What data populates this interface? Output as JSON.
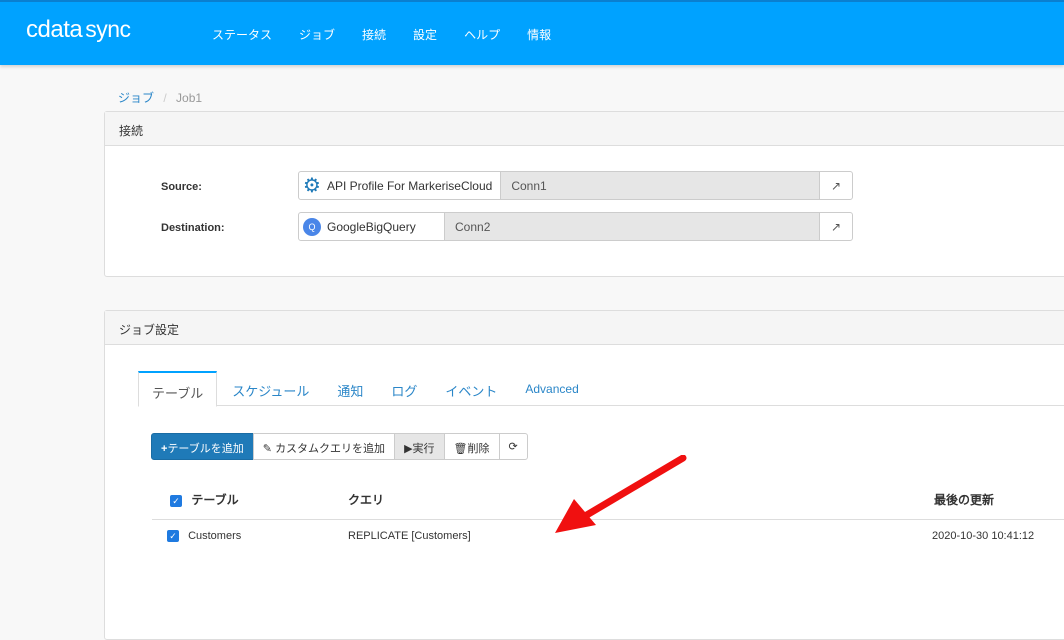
{
  "app": {
    "logo": "cdata",
    "logo_suffix": "sync",
    "accent": "#00a2ff"
  },
  "nav": [
    "ステータス",
    "ジョブ",
    "接続",
    "設定",
    "ヘルプ",
    "情報"
  ],
  "breadcrumb": {
    "parent": "ジョブ",
    "sep": "/",
    "current": "Job1"
  },
  "connections": {
    "title": "接続",
    "source": {
      "label": "Source:",
      "provider": "API Profile For MarkeriseCloud",
      "name": "Conn1"
    },
    "destination": {
      "label": "Destination:",
      "provider": "GoogleBigQuery",
      "name": "Conn2"
    }
  },
  "job": {
    "title": "ジョブ設定",
    "tabs": [
      "テーブル",
      "スケジュール",
      "通知",
      "ログ",
      "イベント",
      "Advanced"
    ],
    "toolbar": {
      "add_table": "テーブルを追加",
      "add_query": "カスタムクエリを追加",
      "run": "実行",
      "delete": "削除"
    },
    "columns": [
      "テーブル",
      "クエリ",
      "最後の更新"
    ],
    "rows": [
      {
        "table": "Customers",
        "query": "REPLICATE [Customers]",
        "updated": "2020-10-30 10:41:12"
      }
    ]
  }
}
